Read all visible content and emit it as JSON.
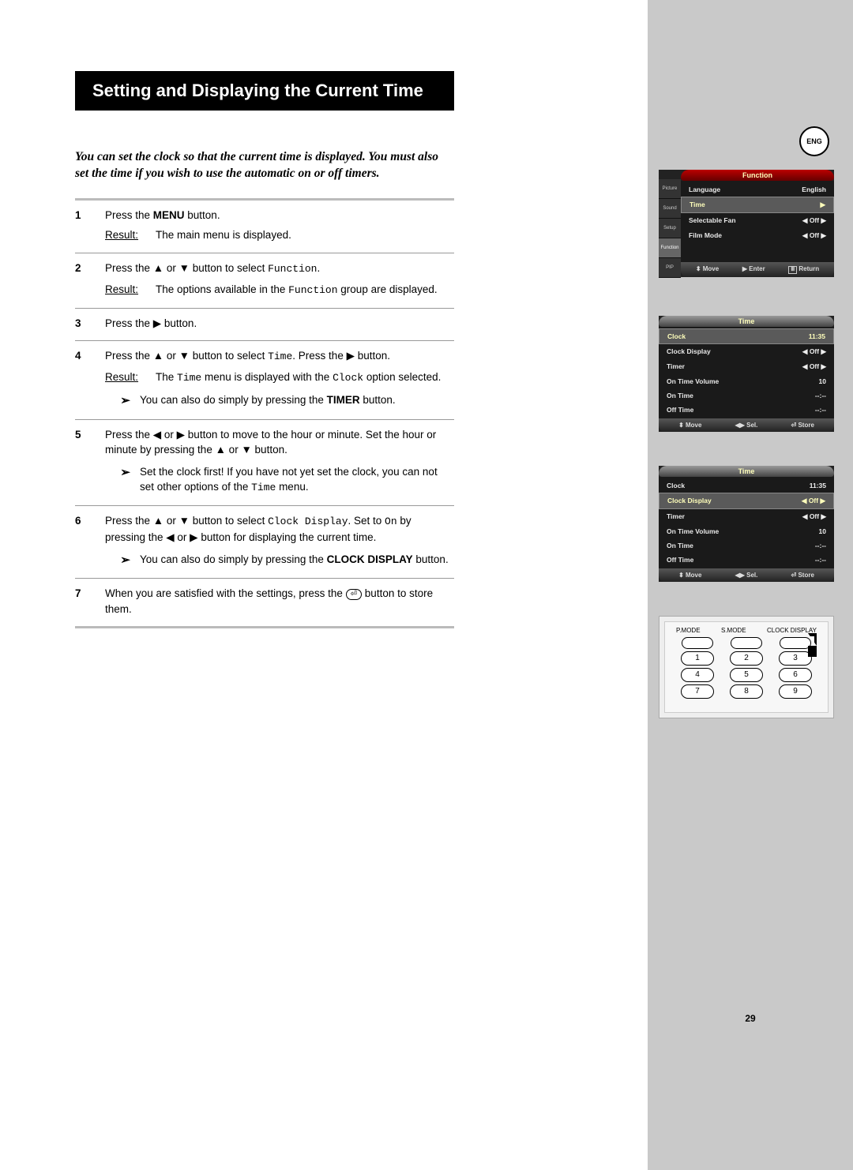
{
  "title": "Setting and Displaying the Current Time",
  "lang_badge": "ENG",
  "page_number": "29",
  "intro": "You can set the clock so that the current time is displayed. You must also set the time if you wish to use the automatic on or off timers.",
  "result_label": "Result:",
  "steps": {
    "1": {
      "text": "Press the MENU button.",
      "result": "The main menu is displayed."
    },
    "2": {
      "text_a": "Press the ▲ or ▼ button to select ",
      "mono": "Function",
      "text_b": ".",
      "result_a": "The options available in the ",
      "result_mono": "Function",
      "result_b": " group are displayed."
    },
    "3": {
      "text": "Press the ▶ button."
    },
    "4": {
      "text_a": "Press the ▲ or ▼ button to select ",
      "mono": "Time",
      "text_b": ". Press the ▶ button.",
      "result_a": "The ",
      "result_mono1": "Time",
      "result_mid": " menu is displayed with the ",
      "result_mono2": "Clock",
      "result_b": " option selected.",
      "note": "You can also do simply by pressing the TIMER button."
    },
    "5": {
      "text": "Press the ◀ or ▶ button to move to the hour or minute. Set the hour or minute by pressing the ▲ or ▼ button.",
      "note_a": "Set the clock first! If you have not yet set the clock, you can not set other options of the ",
      "note_mono": "Time",
      "note_b": " menu."
    },
    "6": {
      "text_a": "Press the ▲ or ▼ button to select ",
      "mono": "Clock Display",
      "text_b": ". Set to ",
      "mono2": "On",
      "text_c": " by pressing the ◀ or ▶ button for displaying the current time.",
      "note": "You can also do simply by pressing the CLOCK DISPLAY button."
    },
    "7": {
      "text_a": "When you are satisfied with the settings, press the ",
      "store_icon": "⏎",
      "text_b": " button to store them."
    }
  },
  "osd1": {
    "title": "Function",
    "tabs": [
      "Picture",
      "Sound",
      "Setup",
      "Function",
      "PIP"
    ],
    "rows": [
      {
        "label": "Language",
        "val": "English"
      },
      {
        "label": "Time",
        "val": "▶"
      },
      {
        "label": "Selectable Fan",
        "val": "◀  Off  ▶"
      },
      {
        "label": "Film Mode",
        "val": "◀  Off  ▶"
      }
    ],
    "footer": {
      "move": "Move",
      "enter": "Enter",
      "return": "Return"
    }
  },
  "osd2": {
    "title": "Time",
    "rows": [
      {
        "label": "Clock",
        "val": "11:35"
      },
      {
        "label": "Clock Display",
        "val": "◀  Off  ▶"
      },
      {
        "label": "Timer",
        "val": "◀  Off  ▶"
      },
      {
        "label": "On Time Volume",
        "val": "10"
      },
      {
        "label": "On Time",
        "val": "--:--"
      },
      {
        "label": "Off Time",
        "val": "--:--"
      }
    ],
    "footer": {
      "move": "Move",
      "sel": "Sel.",
      "store": "Store"
    }
  },
  "osd3": {
    "title": "Time",
    "rows": [
      {
        "label": "Clock",
        "val": "11:35"
      },
      {
        "label": "Clock Display",
        "val": "◀  Off  ▶"
      },
      {
        "label": "Timer",
        "val": "◀  Off  ▶"
      },
      {
        "label": "On Time Volume",
        "val": "10"
      },
      {
        "label": "On Time",
        "val": "--:--"
      },
      {
        "label": "Off Time",
        "val": "--:--"
      }
    ],
    "footer": {
      "move": "Move",
      "sel": "Sel.",
      "store": "Store"
    }
  },
  "remote": {
    "labels": [
      "P.MODE",
      "S.MODE",
      "CLOCK DISPLAY"
    ],
    "row1": [
      "",
      "",
      ""
    ],
    "row2": [
      "1",
      "2",
      "3"
    ],
    "row3": [
      "4",
      "5",
      "6"
    ],
    "row4": [
      "7",
      "8",
      "9"
    ]
  }
}
